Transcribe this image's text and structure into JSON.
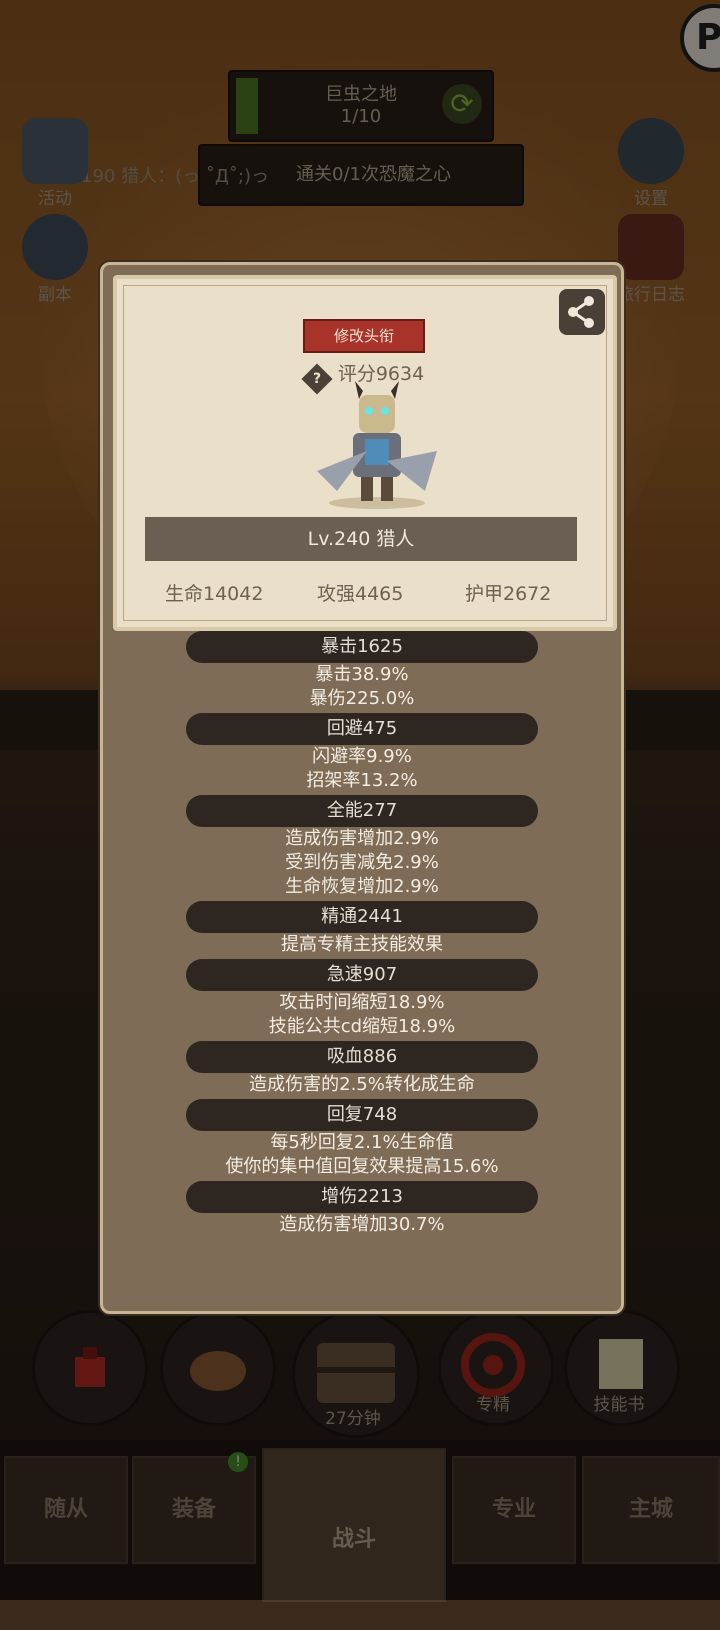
{
  "stage": {
    "name": "巨虫之地",
    "progress": "1/10"
  },
  "quest": {
    "text": "通关0/1次恐魔之心"
  },
  "player_line": "Lv.190 猎人：(っ ˚Д˚;)っ",
  "side_left": [
    {
      "label": "活动",
      "icon": "scroll-icon"
    },
    {
      "label": "副本",
      "icon": "portal-icon"
    }
  ],
  "side_right": [
    {
      "label": "设置",
      "icon": "gear-icon"
    },
    {
      "label": "旅行日志",
      "icon": "book-icon"
    }
  ],
  "badge": {
    "letter": "P"
  },
  "modal": {
    "title_button": "修改头衔",
    "score": "评分9634",
    "score_help": "?",
    "level_class": "Lv.240 猎人",
    "base_stats": [
      "生命14042",
      "攻强4465",
      "护甲2672"
    ],
    "stats": [
      {
        "header": "暴击1625",
        "details": [
          "暴击38.9%",
          "暴伤225.0%"
        ]
      },
      {
        "header": "回避475",
        "details": [
          "闪避率9.9%",
          "招架率13.2%"
        ]
      },
      {
        "header": "全能277",
        "details": [
          "造成伤害增加2.9%",
          "受到伤害减免2.9%",
          "生命恢复增加2.9%"
        ]
      },
      {
        "header": "精通2441",
        "details": [
          "提高专精主技能效果"
        ]
      },
      {
        "header": "急速907",
        "details": [
          "攻击时间缩短18.9%",
          "技能公共cd缩短18.9%"
        ]
      },
      {
        "header": "吸血886",
        "details": [
          "造成伤害的2.5%转化成生命"
        ]
      },
      {
        "header": "回复748",
        "details": [
          "每5秒回复2.1%生命值",
          "使你的集中值回复效果提高15.6%"
        ]
      },
      {
        "header": "增伤2213",
        "details": [
          "造成伤害增加30.7%"
        ]
      }
    ]
  },
  "bottom_buttons": [
    {
      "label": "",
      "icon": "potion-icon"
    },
    {
      "label": "",
      "icon": "bread-icon"
    },
    {
      "label": "27分钟",
      "icon": "chest-icon"
    },
    {
      "label": "专精",
      "icon": "target-icon"
    },
    {
      "label": "技能书",
      "icon": "skillbook-icon"
    }
  ],
  "nav": {
    "tabs": [
      "随从",
      "装备",
      "战斗",
      "专业",
      "主城"
    ],
    "active": "战斗",
    "badge": "!"
  },
  "colors": {
    "title_button": "#a8332b",
    "card": "#eadfc8",
    "modal": "#7e6c57",
    "stat_header": "#2d2621"
  }
}
